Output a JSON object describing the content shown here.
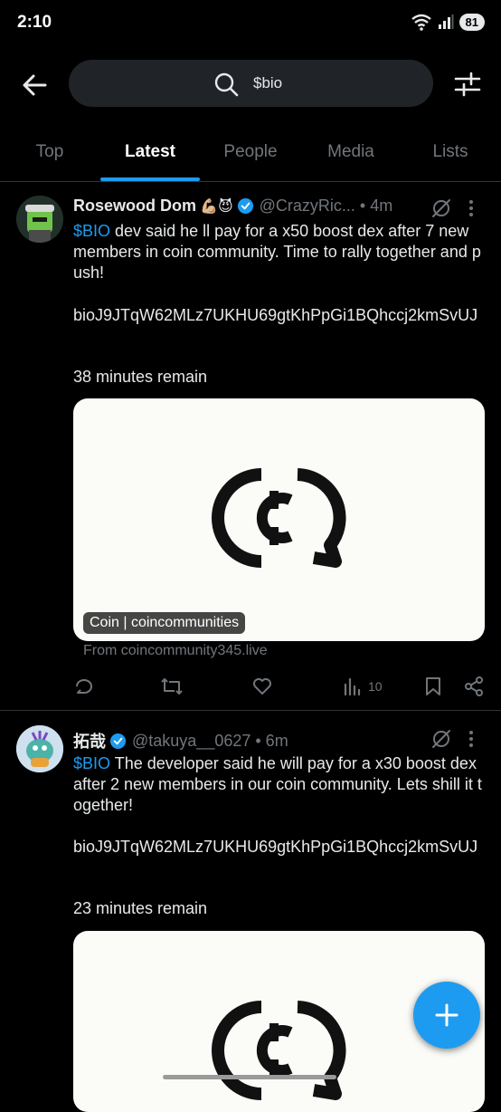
{
  "status_bar": {
    "time": "2:10",
    "battery": "81"
  },
  "search": {
    "query": "$bio"
  },
  "tabs": [
    {
      "label": "Top"
    },
    {
      "label": "Latest"
    },
    {
      "label": "People"
    },
    {
      "label": "Media"
    },
    {
      "label": "Lists"
    }
  ],
  "active_tab": "Latest",
  "posts": [
    {
      "author": "Rosewood Dom",
      "emojis": "💪🏼😈",
      "handle": "@CrazyRic...",
      "time": "• 4m",
      "cashtag": "$BIO",
      "text_after_cashtag": " dev said he ll pay for a x50 boost dex after 7 new members in coin community. Time to rally together and push!",
      "address": "bioJ9JTqW62MLz7UKHU69gtKhPpGi1BQhccj2kmSvUJ",
      "remaining": "38 minutes remain",
      "card_badge": "Coin | coincommunities",
      "card_source": "From coincommunity345.live",
      "views": "10"
    },
    {
      "author": "拓哉",
      "handle": "@takuya__0627",
      "time": "• 6m",
      "cashtag": "$BIO",
      "text_after_cashtag": " The developer said he will pay for a x30 boost dex after 2 new members in our coin community. Lets shill it together!",
      "address": "bioJ9JTqW62MLz7UKHU69gtKhPpGi1BQhccj2kmSvUJ",
      "remaining": "23 minutes remain"
    }
  ],
  "colors": {
    "accent": "#1d9bf0",
    "background": "#000000",
    "secondary_text": "#71767b"
  }
}
